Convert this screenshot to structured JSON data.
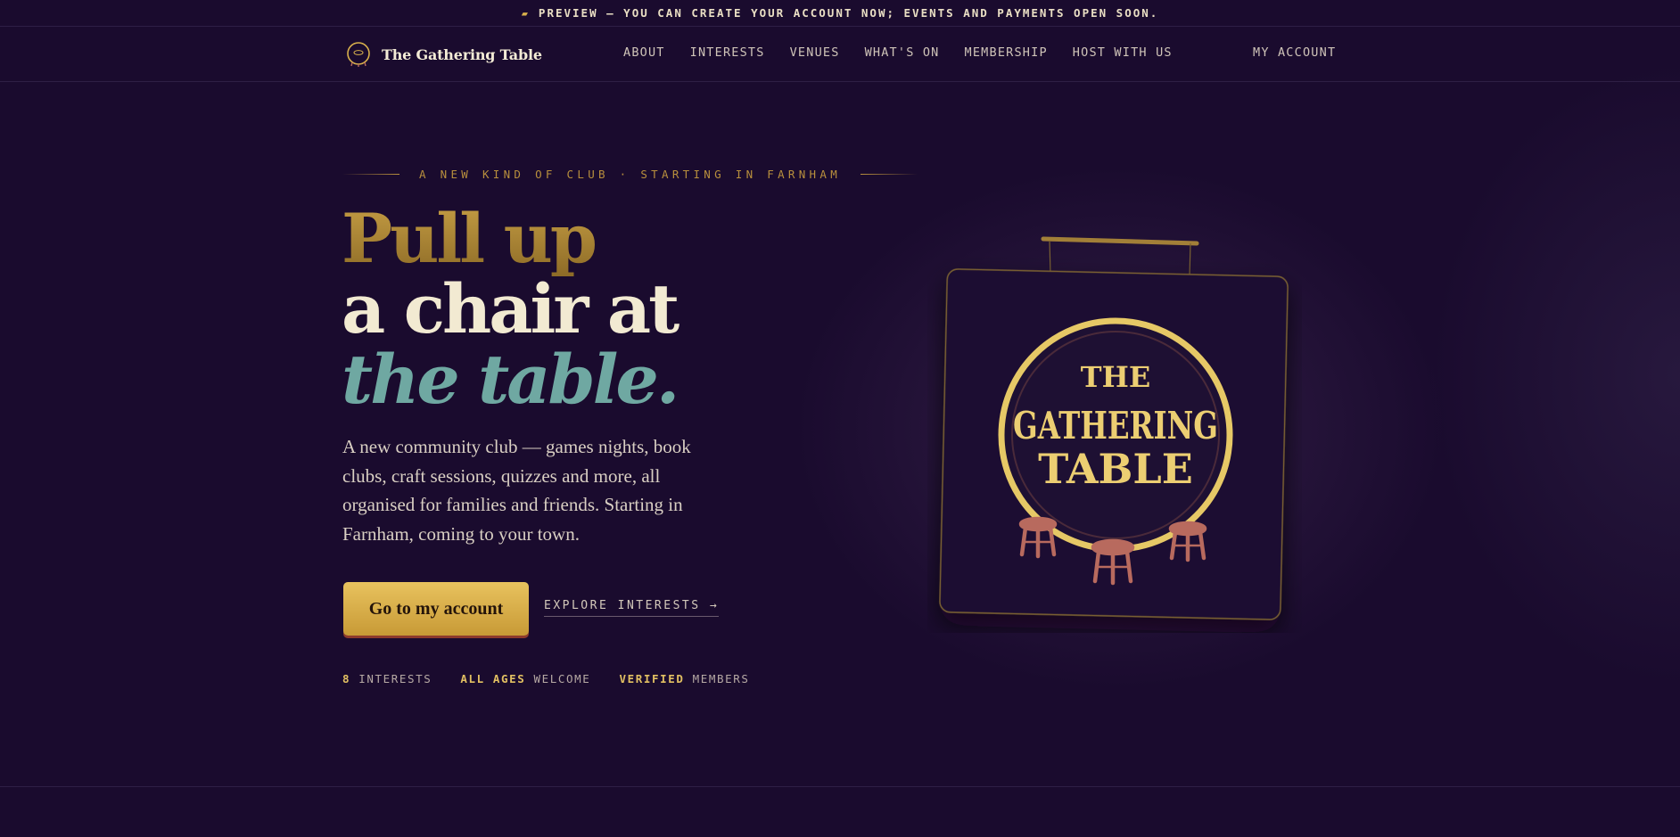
{
  "preview_bar": {
    "icon": "flag-icon",
    "text": "PREVIEW — YOU CAN CREATE YOUR ACCOUNT NOW; EVENTS AND PAYMENTS OPEN SOON."
  },
  "nav": {
    "brand": "The Gathering Table",
    "links": [
      "ABOUT",
      "INTERESTS",
      "VENUES",
      "WHAT'S ON",
      "MEMBERSHIP",
      "HOST WITH US"
    ],
    "account": "MY ACCOUNT"
  },
  "hero": {
    "eyebrow": "A NEW KIND OF CLUB · STARTING IN FARNHAM",
    "headline_line1": "Pull up",
    "headline_line2": "a chair at",
    "headline_line3": "the table.",
    "lead": "A new community club — games nights, book clubs, craft sessions, quizzes and more, all organised for families and friends. Starting in Farnham, coming to your town.",
    "cta_label": "Go to my account",
    "explore_label": "EXPLORE INTERESTS →",
    "stats": [
      {
        "strong": "8",
        "rest": " INTERESTS"
      },
      {
        "strong": "ALL AGES",
        "rest": " WELCOME"
      },
      {
        "strong": "VERIFIED",
        "rest": " MEMBERS"
      }
    ]
  },
  "sign": {
    "line1": "THE",
    "line2": "GATHERING",
    "line3": "TABLE"
  },
  "colors": {
    "background": "#1a0b2e",
    "gold": "#e2c062",
    "teal": "#6fa8a2",
    "cream": "#f2ead2",
    "stool": "#b86a5e"
  }
}
